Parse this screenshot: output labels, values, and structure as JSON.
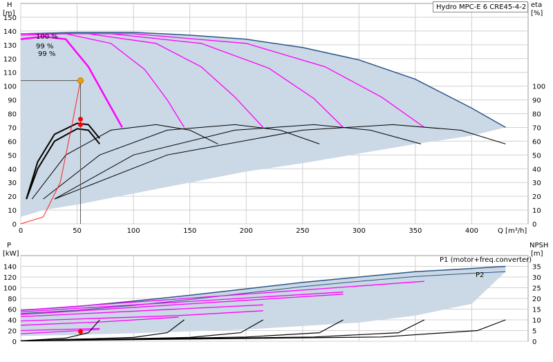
{
  "title": "Hydro MPC-E 6 CRE45-4-2",
  "chart_data": [
    {
      "type": "line",
      "name": "head-efficiency",
      "ylabel_left": "H",
      "yunit_left": "[m]",
      "ylabel_right": "eta",
      "yunit_right": "[%]",
      "xlabel": "Q [m³/h]",
      "xlim": [
        0,
        450
      ],
      "ylim_left": [
        0,
        160
      ],
      "ylim_right": [
        0,
        160
      ],
      "x_ticks": [
        0,
        50,
        100,
        150,
        200,
        250,
        300,
        350,
        400
      ],
      "y_ticks_left": [
        0,
        10,
        20,
        30,
        40,
        50,
        60,
        70,
        80,
        90,
        100,
        110,
        120,
        130,
        140,
        150
      ],
      "y_ticks_right": [
        0,
        10,
        20,
        30,
        40,
        50,
        60,
        70,
        80,
        90,
        100
      ],
      "speed_labels": [
        "100 %",
        "99 %",
        "99 %"
      ],
      "envelope_top": [
        [
          0,
          138
        ],
        [
          50,
          139
        ],
        [
          100,
          139
        ],
        [
          150,
          137
        ],
        [
          200,
          134
        ],
        [
          250,
          128
        ],
        [
          300,
          119
        ],
        [
          350,
          105
        ],
        [
          400,
          84
        ],
        [
          430,
          70
        ]
      ],
      "envelope_bottom": [
        [
          0,
          5
        ],
        [
          20,
          10
        ],
        [
          50,
          14
        ],
        [
          100,
          22
        ],
        [
          150,
          30
        ],
        [
          200,
          38
        ],
        [
          250,
          44
        ],
        [
          300,
          51
        ],
        [
          350,
          58
        ],
        [
          400,
          64
        ],
        [
          430,
          70
        ]
      ],
      "series": [
        {
          "values": [
            [
              0,
              134
            ],
            [
              20,
              136
            ],
            [
              40,
              134
            ],
            [
              60,
              114
            ],
            [
              75,
              92
            ],
            [
              90,
              70
            ]
          ]
        },
        {
          "values": [
            [
              0,
              137
            ],
            [
              40,
              138
            ],
            [
              80,
              131
            ],
            [
              110,
              112
            ],
            [
              130,
              90
            ],
            [
              145,
              70
            ]
          ]
        },
        {
          "values": [
            [
              0,
              138
            ],
            [
              60,
              138
            ],
            [
              120,
              131
            ],
            [
              160,
              114
            ],
            [
              190,
              92
            ],
            [
              215,
              70
            ]
          ]
        },
        {
          "values": [
            [
              0,
              138
            ],
            [
              80,
              138
            ],
            [
              160,
              131
            ],
            [
              220,
              113
            ],
            [
              260,
              91
            ],
            [
              286,
              70
            ]
          ]
        },
        {
          "values": [
            [
              0,
              138
            ],
            [
              100,
              138
            ],
            [
              200,
              131
            ],
            [
              270,
              114
            ],
            [
              320,
              92
            ],
            [
              358,
              70
            ]
          ]
        },
        {
          "values": [
            [
              0,
              138
            ],
            [
              50,
              139
            ],
            [
              100,
              139
            ],
            [
              150,
              137
            ],
            [
              200,
              134
            ],
            [
              250,
              128
            ],
            [
              300,
              119
            ],
            [
              350,
              105
            ],
            [
              400,
              84
            ],
            [
              430,
              70
            ]
          ]
        }
      ],
      "efficiency_series": [
        {
          "values": [
            [
              5,
              18
            ],
            [
              15,
              45
            ],
            [
              30,
              65
            ],
            [
              50,
              73
            ],
            [
              60,
              72
            ],
            [
              70,
              62
            ]
          ]
        },
        {
          "values": [
            [
              5,
              18
            ],
            [
              15,
              40
            ],
            [
              30,
              60
            ],
            [
              50,
              69
            ],
            [
              60,
              68
            ],
            [
              70,
              58
            ]
          ]
        },
        {
          "values": [
            [
              10,
              18
            ],
            [
              40,
              50
            ],
            [
              80,
              68
            ],
            [
              120,
              72
            ],
            [
              150,
              68
            ],
            [
              175,
              58
            ]
          ]
        },
        {
          "values": [
            [
              20,
              18
            ],
            [
              70,
              50
            ],
            [
              130,
              68
            ],
            [
              190,
              72
            ],
            [
              230,
              68
            ],
            [
              265,
              58
            ]
          ]
        },
        {
          "values": [
            [
              30,
              18
            ],
            [
              100,
              50
            ],
            [
              190,
              68
            ],
            [
              260,
              72
            ],
            [
              310,
              68
            ],
            [
              355,
              58
            ]
          ]
        },
        {
          "values": [
            [
              30,
              18
            ],
            [
              130,
              50
            ],
            [
              250,
              68
            ],
            [
              330,
              72
            ],
            [
              390,
              68
            ],
            [
              430,
              58
            ]
          ]
        }
      ],
      "system_curve": [
        [
          0,
          0
        ],
        [
          20,
          5
        ],
        [
          35,
          30
        ],
        [
          45,
          70
        ],
        [
          53,
          104
        ]
      ],
      "duty_point": {
        "Q": 53,
        "H": 104
      },
      "eta_points": [
        {
          "Q": 53,
          "eta": 76
        },
        {
          "Q": 53,
          "eta": 72
        }
      ]
    },
    {
      "type": "line",
      "name": "power-npsh",
      "ylabel_left": "P",
      "yunit_left": "[kW]",
      "ylabel_right": "NPSH",
      "yunit_right": "[m]",
      "xlim": [
        0,
        450
      ],
      "ylim_left": [
        0,
        160
      ],
      "ylim_right": [
        0,
        40
      ],
      "y_ticks_left": [
        0,
        20,
        40,
        60,
        80,
        100,
        120,
        140
      ],
      "y_ticks_right": [
        0,
        5,
        10,
        15,
        20,
        25,
        30,
        35
      ],
      "legend": [
        "P1 (motor+freq.converter)",
        "P2"
      ],
      "p1": [
        [
          0,
          58
        ],
        [
          50,
          65
        ],
        [
          100,
          75
        ],
        [
          150,
          86
        ],
        [
          200,
          98
        ],
        [
          250,
          110
        ],
        [
          300,
          120
        ],
        [
          350,
          130
        ],
        [
          400,
          136
        ],
        [
          430,
          140
        ]
      ],
      "p2": [
        [
          0,
          52
        ],
        [
          50,
          58
        ],
        [
          100,
          67
        ],
        [
          150,
          78
        ],
        [
          200,
          90
        ],
        [
          250,
          102
        ],
        [
          300,
          112
        ],
        [
          350,
          121
        ],
        [
          400,
          127
        ],
        [
          430,
          130
        ]
      ],
      "p_lower_boundary": [
        [
          0,
          10
        ],
        [
          50,
          12
        ],
        [
          100,
          15
        ],
        [
          200,
          22
        ],
        [
          300,
          35
        ],
        [
          350,
          48
        ],
        [
          400,
          70
        ],
        [
          430,
          130
        ]
      ],
      "partial_power": [
        {
          "values": [
            [
              0,
              14
            ],
            [
              70,
              22
            ]
          ]
        },
        {
          "values": [
            [
              0,
              20
            ],
            [
              70,
              24
            ]
          ]
        },
        {
          "values": [
            [
              0,
              30
            ],
            [
              70,
              36
            ],
            [
              140,
              45
            ]
          ]
        },
        {
          "values": [
            [
              0,
              38
            ],
            [
              140,
              48
            ],
            [
              215,
              57
            ]
          ]
        },
        {
          "values": [
            [
              0,
              46
            ],
            [
              215,
              68
            ]
          ]
        },
        {
          "values": [
            [
              0,
              50
            ],
            [
              286,
              88
            ]
          ]
        },
        {
          "values": [
            [
              0,
              55
            ],
            [
              286,
              92
            ]
          ]
        },
        {
          "values": [
            [
              0,
              58
            ],
            [
              358,
              112
            ]
          ]
        }
      ],
      "npsh": [
        {
          "values": [
            [
              0,
              0.2
            ],
            [
              40,
              1.5
            ],
            [
              60,
              4
            ],
            [
              70,
              10
            ]
          ]
        },
        {
          "values": [
            [
              0,
              0.2
            ],
            [
              100,
              1.8
            ],
            [
              130,
              4
            ],
            [
              145,
              10
            ]
          ]
        },
        {
          "values": [
            [
              0,
              0.2
            ],
            [
              150,
              1.8
            ],
            [
              195,
              4
            ],
            [
              215,
              10
            ]
          ]
        },
        {
          "values": [
            [
              0,
              0.2
            ],
            [
              200,
              2
            ],
            [
              265,
              4
            ],
            [
              286,
              10
            ]
          ]
        },
        {
          "values": [
            [
              0,
              0.2
            ],
            [
              260,
              2
            ],
            [
              335,
              4
            ],
            [
              358,
              10
            ]
          ]
        },
        {
          "values": [
            [
              0,
              0.2
            ],
            [
              320,
              2
            ],
            [
              405,
              5
            ],
            [
              430,
              10
            ]
          ]
        }
      ],
      "duty_point": {
        "Q": 53,
        "P": 18
      }
    }
  ],
  "colors": {
    "envelope_fill": "#cbd8e5",
    "envelope_edge": "#2a5485",
    "speed_curve": "#ff00ff",
    "efficiency": "#000000",
    "system_curve": "#ff2020",
    "duty_point": "#f5a000",
    "grid": "#d0d0d0"
  }
}
